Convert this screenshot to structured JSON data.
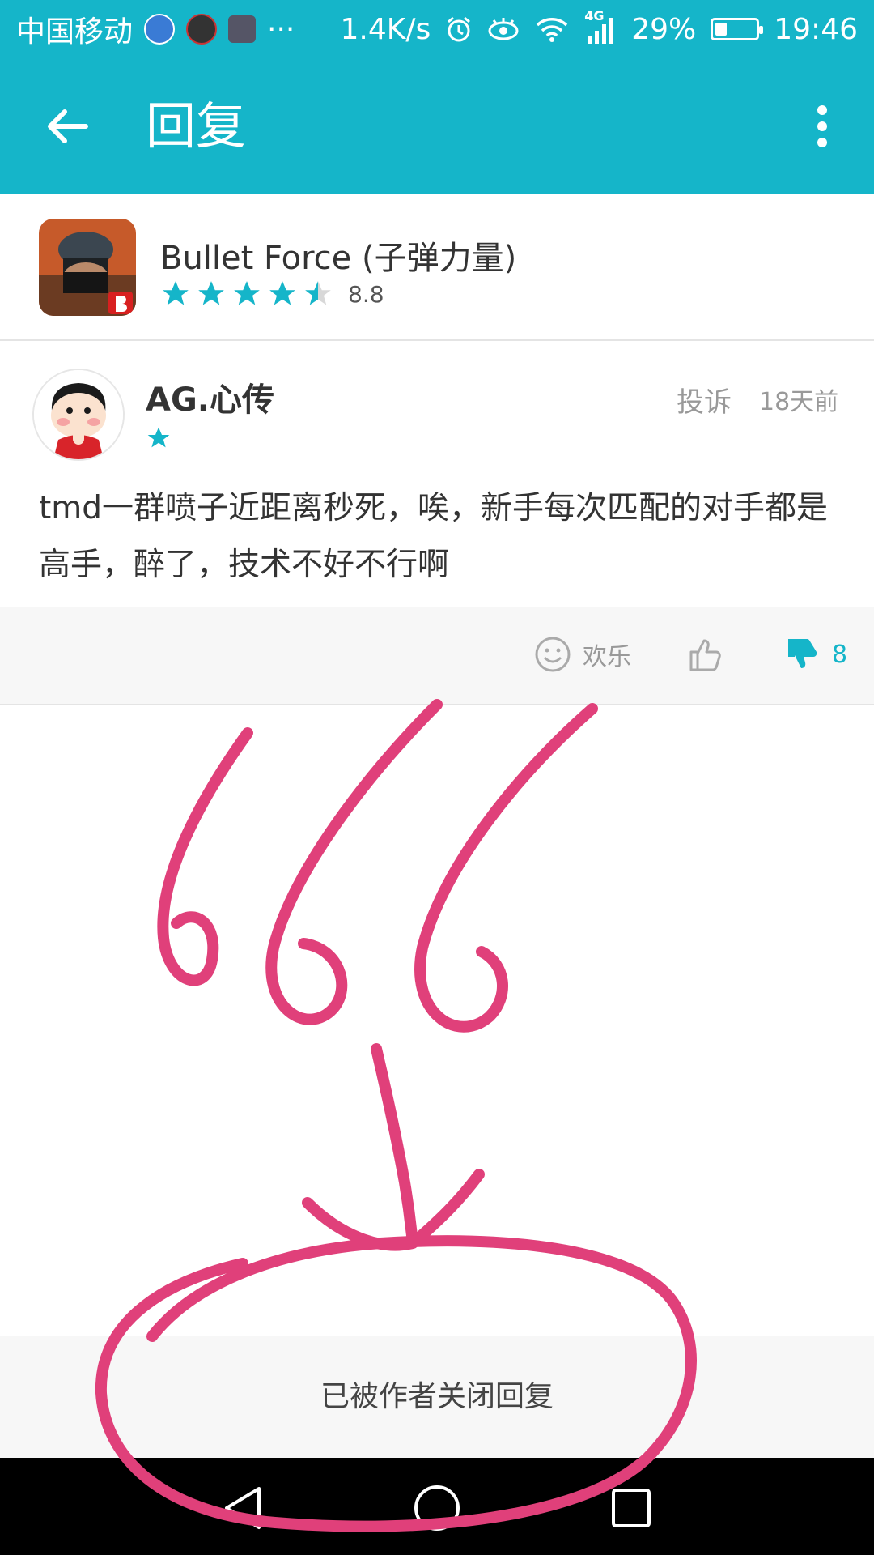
{
  "status_bar": {
    "carrier": "中国移动",
    "speed": "1.4K/s",
    "network": "4G",
    "battery": "29%",
    "battery_level": 0.29,
    "time": "19:46",
    "overflow": "···"
  },
  "toolbar": {
    "title": "回复"
  },
  "app": {
    "name": "Bullet Force (子弹力量)",
    "rating": "8.8",
    "stars": 4.5
  },
  "review": {
    "username": "AG.心传",
    "user_stars": 1,
    "report_label": "投诉",
    "time_ago": "18天前",
    "text": "tmd一群喷子近距离秒死，唉，新手每次匹配的对手都是高手，醉了，技术不好不行啊"
  },
  "actions": {
    "happy_label": "欢乐",
    "dislike_count": "8"
  },
  "closed_notice": "已被作者关闭回复",
  "annotation": "666",
  "colors": {
    "accent": "#15b5c9",
    "scribble": "#e0407a"
  },
  "icons": [
    "back-arrow-icon",
    "more-vert-icon",
    "star-icon",
    "smiley-icon",
    "thumbs-up-icon",
    "thumbs-down-icon",
    "nav-back-icon",
    "nav-home-icon",
    "nav-recent-icon"
  ]
}
